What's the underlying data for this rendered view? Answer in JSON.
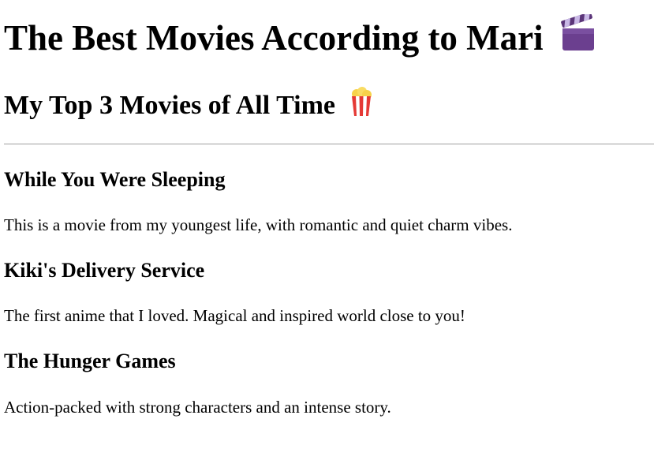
{
  "page": {
    "title": "The Best Movies According to Mari",
    "title_icon": "clapperboard-icon",
    "subtitle": "My Top 3 Movies of All Time",
    "subtitle_icon": "popcorn-icon"
  },
  "movies": [
    {
      "title": "While You Were Sleeping",
      "description": "This is a movie from my youngest life, with romantic and quiet charm vibes."
    },
    {
      "title": "Kiki's Delivery Service",
      "description": "The first anime that I loved. Magical and inspired world close to you!"
    },
    {
      "title": "The Hunger Games",
      "description": "Action-packed with strong characters and an intense story."
    }
  ]
}
